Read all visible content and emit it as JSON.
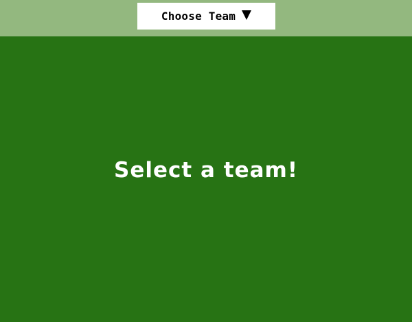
{
  "colors": {
    "background": "#277314",
    "topbar": "#93b87f",
    "dropdown_bg": "#ffffff",
    "dropdown_text": "#000000",
    "message_text": "#ffffff"
  },
  "header": {
    "team_select": {
      "label": "Choose Team",
      "icon": "caret-down-icon"
    }
  },
  "main": {
    "message": "Select a team!"
  }
}
